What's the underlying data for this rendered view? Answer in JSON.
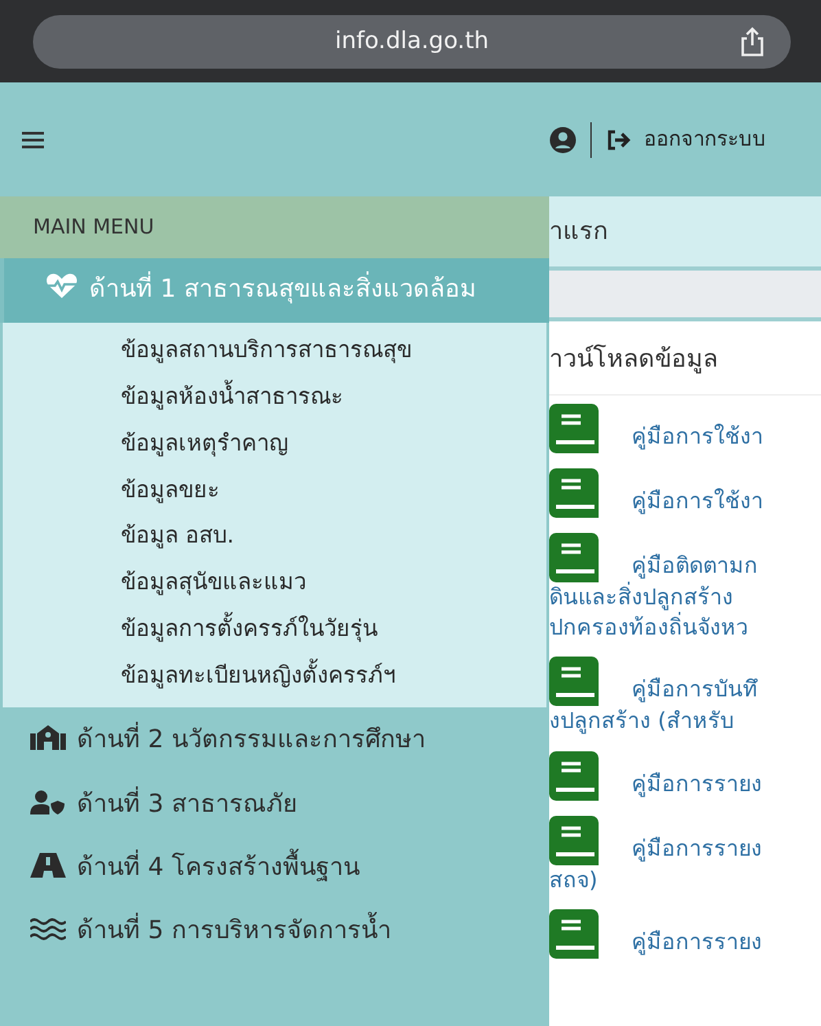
{
  "browser": {
    "url": "info.dla.go.th"
  },
  "header": {
    "logout_label": "ออกจากระบบ"
  },
  "sidebar": {
    "title": "MAIN MENU",
    "items": [
      {
        "label": "ด้านที่ 1 สาธารณสุขและสิ่งแวดล้อม",
        "selected": true,
        "expanded": true,
        "children": [
          {
            "label": "ข้อมูลสถานบริการสาธารณสุข"
          },
          {
            "label": "ข้อมูลห้องน้ำสาธารณะ"
          },
          {
            "label": "ข้อมูลเหตุรำคาญ"
          },
          {
            "label": "ข้อมูลขยะ"
          },
          {
            "label": "ข้อมูล อสบ."
          },
          {
            "label": "ข้อมูลสุนัขและแมว"
          },
          {
            "label": "ข้อมูลการตั้งครรภ์ในวัยรุ่น"
          },
          {
            "label": "ข้อมูลทะเบียนหญิงตั้งครรภ์ฯ"
          }
        ]
      },
      {
        "label": "ด้านที่ 2 นวัตกรรมและการศึกษา",
        "selected": false
      },
      {
        "label": "ด้านที่ 3 สาธารณภัย",
        "selected": false
      },
      {
        "label": "ด้านที่ 4 โครงสร้างพื้นฐาน",
        "selected": false
      },
      {
        "label": "ด้านที่ 5 การบริหารจัดการน้ำ",
        "selected": false
      }
    ]
  },
  "main": {
    "breadcrumb": "าแรก",
    "section_title": "าวน์โหลดข้อมูล",
    "documents": [
      {
        "lines": [
          "คู่มือการใช้งา"
        ]
      },
      {
        "lines": [
          "คู่มือการใช้งา"
        ]
      },
      {
        "lines": [
          "คู่มือติดตามก",
          "ดินและสิ่งปลูกสร้าง",
          "ปกครองท้องถิ่นจังหว"
        ]
      },
      {
        "lines": [
          "คู่มือการบันทึ",
          "งปลูกสร้าง (สำหรับ"
        ]
      },
      {
        "lines": [
          "คู่มือการรายง"
        ]
      },
      {
        "lines": [
          "คู่มือการรายง",
          "สถจ)"
        ]
      },
      {
        "lines": [
          "คู่มือการรายง"
        ]
      }
    ]
  }
}
